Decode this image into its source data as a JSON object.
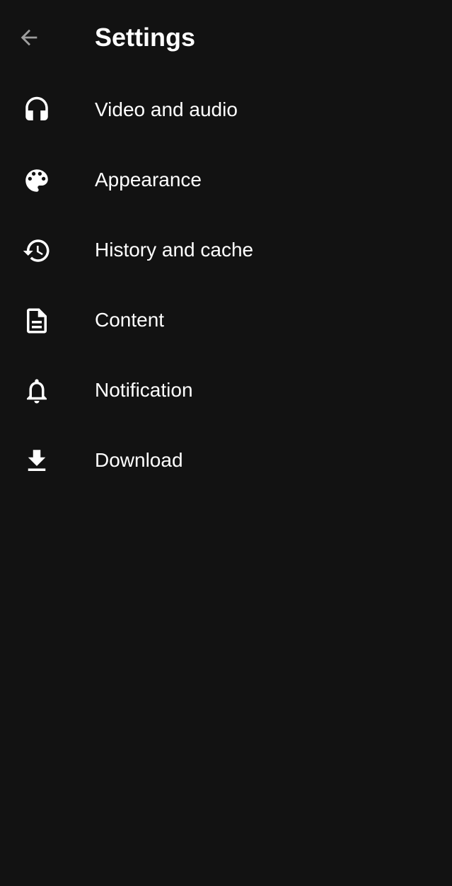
{
  "header": {
    "title": "Settings",
    "back_icon": "arrow-back-icon"
  },
  "colors": {
    "background": "#121212",
    "text": "#ffffff",
    "back_icon": "#9e9e9e"
  },
  "settings": {
    "items": [
      {
        "label": "Video and audio",
        "icon": "headphones-icon"
      },
      {
        "label": "Appearance",
        "icon": "palette-icon"
      },
      {
        "label": "History and cache",
        "icon": "history-icon"
      },
      {
        "label": "Content",
        "icon": "document-icon"
      },
      {
        "label": "Notification",
        "icon": "bell-icon"
      },
      {
        "label": "Download",
        "icon": "download-icon"
      }
    ]
  }
}
